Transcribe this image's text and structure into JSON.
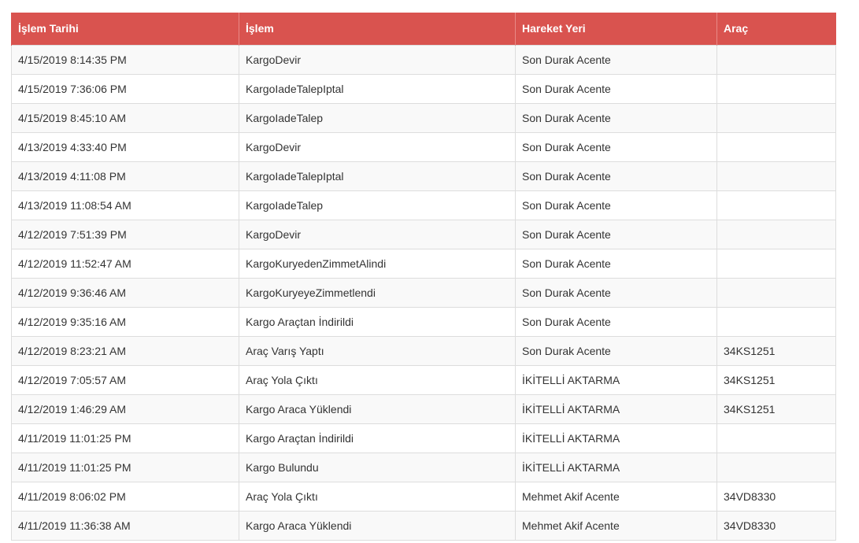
{
  "table": {
    "headers": [
      "İşlem Tarihi",
      "İşlem",
      "Hareket Yeri",
      "Araç"
    ],
    "rows": [
      [
        "4/15/2019 8:14:35 PM",
        "KargoDevir",
        "Son Durak Acente",
        ""
      ],
      [
        "4/15/2019 7:36:06 PM",
        "KargoIadeTalepIptal",
        "Son Durak Acente",
        ""
      ],
      [
        "4/15/2019 8:45:10 AM",
        "KargoIadeTalep",
        "Son Durak Acente",
        ""
      ],
      [
        "4/13/2019 4:33:40 PM",
        "KargoDevir",
        "Son Durak Acente",
        ""
      ],
      [
        "4/13/2019 4:11:08 PM",
        "KargoIadeTalepIptal",
        "Son Durak Acente",
        ""
      ],
      [
        "4/13/2019 11:08:54 AM",
        "KargoIadeTalep",
        "Son Durak Acente",
        ""
      ],
      [
        "4/12/2019 7:51:39 PM",
        "KargoDevir",
        "Son Durak Acente",
        ""
      ],
      [
        "4/12/2019 11:52:47 AM",
        "KargoKuryedenZimmetAlindi",
        "Son Durak Acente",
        ""
      ],
      [
        "4/12/2019 9:36:46 AM",
        "KargoKuryeyeZimmetlendi",
        "Son Durak Acente",
        ""
      ],
      [
        "4/12/2019 9:35:16 AM",
        "Kargo Araçtan İndirildi",
        "Son Durak Acente",
        ""
      ],
      [
        "4/12/2019 8:23:21 AM",
        "Araç Varış Yaptı",
        "Son Durak Acente",
        "34KS1251"
      ],
      [
        "4/12/2019 7:05:57 AM",
        "Araç Yola Çıktı",
        "İKİTELLİ AKTARMA",
        "34KS1251"
      ],
      [
        "4/12/2019 1:46:29 AM",
        "Kargo Araca Yüklendi",
        "İKİTELLİ AKTARMA",
        "34KS1251"
      ],
      [
        "4/11/2019 11:01:25 PM",
        "Kargo Araçtan İndirildi",
        "İKİTELLİ AKTARMA",
        ""
      ],
      [
        "4/11/2019 11:01:25 PM",
        "Kargo Bulundu",
        "İKİTELLİ AKTARMA",
        ""
      ],
      [
        "4/11/2019 8:06:02 PM",
        "Araç Yola Çıktı",
        "Mehmet Akif Acente",
        "34VD8330"
      ],
      [
        "4/11/2019 11:36:38 AM",
        "Kargo Araca Yüklendi",
        "Mehmet Akif Acente",
        "34VD8330"
      ]
    ]
  },
  "colors": {
    "header_bg": "#d9534f",
    "header_text": "#ffffff",
    "row_odd": "#f9f9f9",
    "row_even": "#ffffff",
    "border": "#dddddd"
  }
}
